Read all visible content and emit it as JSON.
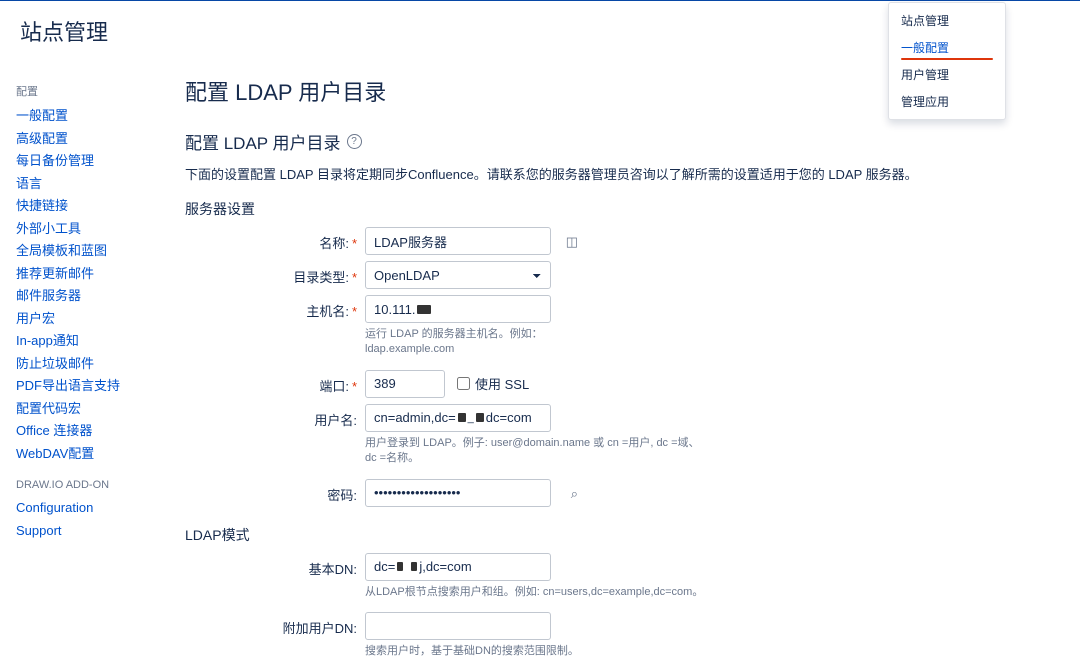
{
  "header": {
    "title": "站点管理"
  },
  "sidebar": {
    "group1_title": "配置",
    "items": [
      "一般配置",
      "高级配置",
      "每日备份管理",
      "语言",
      "快捷链接",
      "外部小工具",
      "全局模板和蓝图",
      "推荐更新邮件",
      "邮件服务器",
      "用户宏",
      "In-app通知",
      "防止垃圾邮件",
      "PDF导出语言支持",
      "配置代码宏",
      "Office 连接器",
      "WebDAV配置"
    ],
    "group2_title": "DRAW.IO ADD-ON",
    "items2": [
      "Configuration",
      "Support"
    ]
  },
  "dropdown": {
    "items": [
      "站点管理",
      "一般配置",
      "用户管理",
      "管理应用"
    ],
    "activeIndex": 1
  },
  "page": {
    "title": "配置 LDAP 用户目录",
    "section_title": "配置 LDAP 用户目录",
    "description": "下面的设置配置 LDAP 目录将定期同步Confluence。请联系您的服务器管理员咨询以了解所需的设置适用于您的 LDAP 服务器。",
    "server_section": "服务器设置",
    "ldap_section": "LDAP模式",
    "fields": {
      "name_label": "名称:",
      "name_value": "LDAP服务器",
      "type_label": "目录类型:",
      "type_value": "OpenLDAP",
      "host_label": "主机名:",
      "host_value": "10.111.",
      "host_help": "运行 LDAP 的服务器主机名。例如： ldap.example.com",
      "port_label": "端口:",
      "port_value": "389",
      "ssl_label": "使用 SSL",
      "user_label": "用户名:",
      "user_prefix": "cn=admin,dc=",
      "user_suffix": " dc=com",
      "user_help": "用户登录到 LDAP。例子: user@domain.name 或 cn =用户, dc =域、dc =名称。",
      "password_label": "密码:",
      "password_value": "•••••••••••••••••••",
      "basedn_label": "基本DN:",
      "basedn_prefix": "dc=",
      "basedn_mid": " j,dc=com",
      "basedn_help": "从LDAP根节点搜索用户和组。例如: cn=users,dc=example,dc=com。",
      "adddn_label": "附加用户DN:",
      "adddn_value": "",
      "adddn_help": "搜索用户时，基于基础DN的搜索范围限制。"
    }
  }
}
